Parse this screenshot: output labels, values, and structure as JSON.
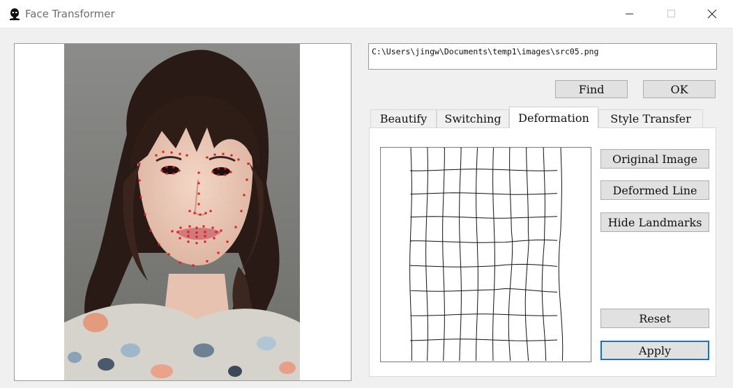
{
  "window": {
    "title": "Face Transformer",
    "icon": "face-silhouette-icon",
    "controls": [
      "minimize-icon",
      "maximize-icon",
      "close-icon"
    ]
  },
  "file": {
    "path": "C:\\Users\\jingw\\Documents\\temp1\\images\\src05.png"
  },
  "buttons": {
    "find": "Find",
    "ok": "OK"
  },
  "tabs": [
    {
      "label": "Beautify",
      "active": false
    },
    {
      "label": "Switching",
      "active": false
    },
    {
      "label": "Deformation",
      "active": true
    },
    {
      "label": "Style Transfer",
      "active": false
    }
  ],
  "deformation": {
    "original_image": "Original Image",
    "deformed_line": "Deformed Line",
    "hide_landmarks": "Hide Landmarks",
    "reset": "Reset",
    "apply": "Apply"
  },
  "colors": {
    "landmark": "#e4161c",
    "focus_border": "#0078d7"
  }
}
